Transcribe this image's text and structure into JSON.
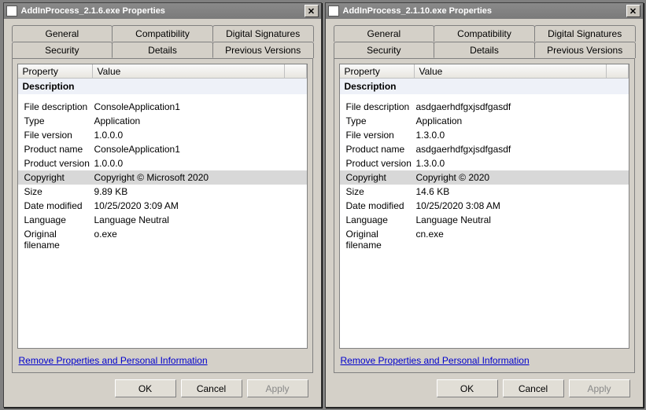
{
  "dialogs": [
    {
      "title": "AddInProcess_2.1.6.exe Properties",
      "tabsRow1": [
        "General",
        "Compatibility",
        "Digital Signatures"
      ],
      "tabsRow2": [
        "Security",
        "Details",
        "Previous Versions"
      ],
      "activeTab": "Details",
      "columns": {
        "property": "Property",
        "value": "Value"
      },
      "group": "Description",
      "rows": [
        {
          "p": "File description",
          "v": "ConsoleApplication1"
        },
        {
          "p": "Type",
          "v": "Application"
        },
        {
          "p": "File version",
          "v": "1.0.0.0"
        },
        {
          "p": "Product name",
          "v": "ConsoleApplication1"
        },
        {
          "p": "Product version",
          "v": "1.0.0.0"
        },
        {
          "p": "Copyright",
          "v": "Copyright © Microsoft 2020",
          "sel": true
        },
        {
          "p": "Size",
          "v": "9.89 KB"
        },
        {
          "p": "Date modified",
          "v": "10/25/2020 3:09 AM"
        },
        {
          "p": "Language",
          "v": "Language Neutral"
        },
        {
          "p": "Original filename",
          "v": "o.exe"
        }
      ],
      "link": "Remove Properties and Personal Information",
      "buttons": {
        "ok": "OK",
        "cancel": "Cancel",
        "apply": "Apply"
      }
    },
    {
      "title": "AddInProcess_2.1.10.exe Properties",
      "tabsRow1": [
        "General",
        "Compatibility",
        "Digital Signatures"
      ],
      "tabsRow2": [
        "Security",
        "Details",
        "Previous Versions"
      ],
      "activeTab": "Details",
      "columns": {
        "property": "Property",
        "value": "Value"
      },
      "group": "Description",
      "rows": [
        {
          "p": "File description",
          "v": "asdgaerhdfgxjsdfgasdf"
        },
        {
          "p": "Type",
          "v": "Application"
        },
        {
          "p": "File version",
          "v": "1.3.0.0"
        },
        {
          "p": "Product name",
          "v": "asdgaerhdfgxjsdfgasdf"
        },
        {
          "p": "Product version",
          "v": "1.3.0.0"
        },
        {
          "p": "Copyright",
          "v": "Copyright ©  2020",
          "sel": true
        },
        {
          "p": "Size",
          "v": "14.6 KB"
        },
        {
          "p": "Date modified",
          "v": "10/25/2020 3:08 AM"
        },
        {
          "p": "Language",
          "v": "Language Neutral"
        },
        {
          "p": "Original filename",
          "v": "cn.exe"
        }
      ],
      "link": "Remove Properties and Personal Information",
      "buttons": {
        "ok": "OK",
        "cancel": "Cancel",
        "apply": "Apply"
      }
    }
  ]
}
